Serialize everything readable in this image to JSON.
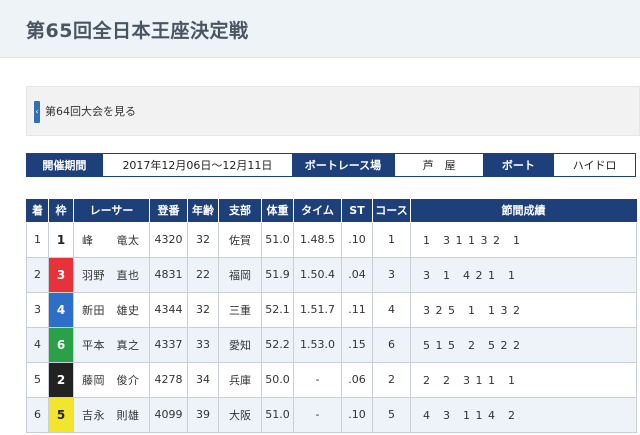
{
  "header": {
    "title": "第65回全日本王座決定戦"
  },
  "prev": {
    "chevron": "‹",
    "link_text": "第64回大会を見る"
  },
  "info": {
    "period_label": "開催期間",
    "period_value": "2017年12月06日〜12月11日",
    "venue_label": "ボートレース場",
    "venue_value": "芦　屋",
    "boat_label": "ボート",
    "boat_value": "ハイドロ"
  },
  "table": {
    "headers": [
      "着",
      "枠",
      "レーサー",
      "登番",
      "年齢",
      "支部",
      "体重",
      "タイム",
      "ST",
      "コース",
      "節間成績"
    ],
    "rows": [
      {
        "place": "1",
        "frame": "1",
        "frame_bg": "#ffffff",
        "frame_fg": "#222222",
        "racer": "峰　　竜太",
        "reg": "4320",
        "age": "32",
        "branch": "佐賀",
        "weight": "51.0",
        "time": "1.48.5",
        "st": ".10",
        "course": "1",
        "record": "1　3 1 1 3 2　1"
      },
      {
        "place": "2",
        "frame": "3",
        "frame_bg": "#e8323a",
        "frame_fg": "#ffffff",
        "racer": "羽野　直也",
        "reg": "4831",
        "age": "22",
        "branch": "福岡",
        "weight": "51.9",
        "time": "1.50.4",
        "st": ".04",
        "course": "3",
        "record": "3　1　4 2 1　1"
      },
      {
        "place": "3",
        "frame": "4",
        "frame_bg": "#2d6fc6",
        "frame_fg": "#ffffff",
        "racer": "新田　雄史",
        "reg": "4344",
        "age": "32",
        "branch": "三重",
        "weight": "52.1",
        "time": "1.51.7",
        "st": ".11",
        "course": "4",
        "record": "3 2 5　1　1 3 2"
      },
      {
        "place": "4",
        "frame": "6",
        "frame_bg": "#2aa146",
        "frame_fg": "#ffffff",
        "racer": "平本　真之",
        "reg": "4337",
        "age": "33",
        "branch": "愛知",
        "weight": "52.2",
        "time": "1.53.0",
        "st": ".15",
        "course": "6",
        "record": "5 1 5　2　5 2 2"
      },
      {
        "place": "5",
        "frame": "2",
        "frame_bg": "#222222",
        "frame_fg": "#ffffff",
        "racer": "藤岡　俊介",
        "reg": "4278",
        "age": "34",
        "branch": "兵庫",
        "weight": "50.0",
        "time": "-",
        "st": ".06",
        "course": "2",
        "record": "2　2　3 1 1　1"
      },
      {
        "place": "6",
        "frame": "5",
        "frame_bg": "#f2e52c",
        "frame_fg": "#222222",
        "racer": "吉永　則雄",
        "reg": "4099",
        "age": "39",
        "branch": "大阪",
        "weight": "51.0",
        "time": "-",
        "st": ".10",
        "course": "5",
        "record": "4　3　1 1 4　2"
      }
    ]
  }
}
